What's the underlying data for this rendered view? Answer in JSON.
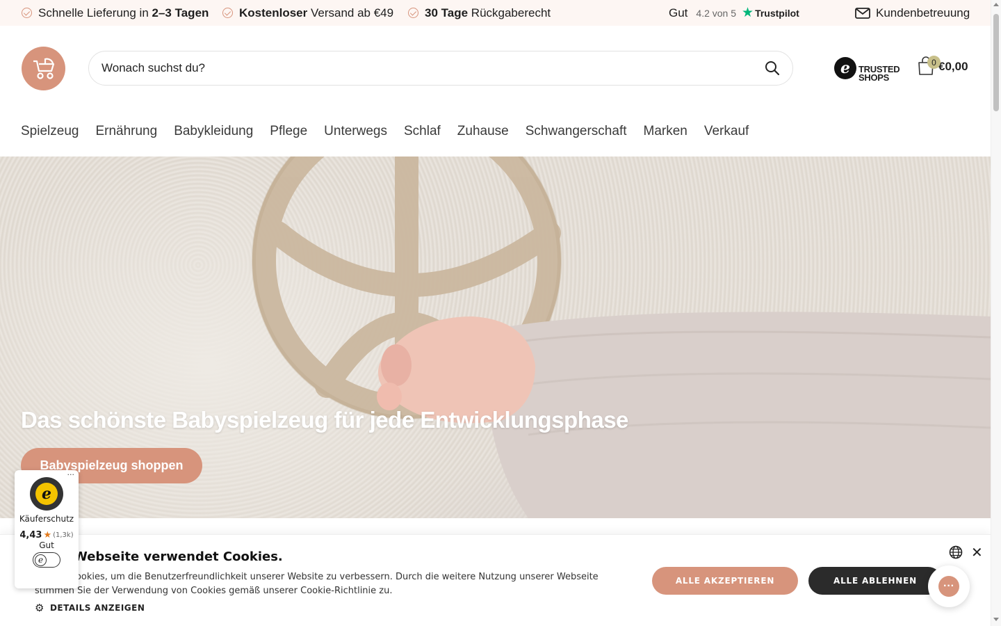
{
  "topbar": {
    "usps": [
      {
        "pre": "Schnelle Lieferung in ",
        "bold": "2–3 Tagen",
        "post": ""
      },
      {
        "pre": "",
        "bold": "Kostenloser",
        "post": " Versand ab €49"
      },
      {
        "pre": "",
        "bold": "30 Tage",
        "post": " Rückgaberecht"
      }
    ],
    "trustpilot": {
      "grade": "Gut",
      "score": "4.2 von 5",
      "brand": "Trustpilot"
    },
    "support_label": "Kundenbetreuung"
  },
  "header": {
    "search_placeholder": "Wonach suchst du?",
    "trusted_shops": {
      "line1": "TRUSTED",
      "line2": "SHOPS"
    },
    "cart": {
      "count": "0",
      "total": "€0,00"
    }
  },
  "nav": [
    "Spielzeug",
    "Ernährung",
    "Babykleidung",
    "Pflege",
    "Unterwegs",
    "Schlaf",
    "Zuhause",
    "Schwangerschaft",
    "Marken",
    "Verkauf"
  ],
  "hero": {
    "title": "Das schönste Babyspielzeug für jede Entwicklungsphase",
    "button": "Babyspielzeug shoppen"
  },
  "cookie": {
    "title": "Webseite verwendet Cookies.",
    "text": "…nden Cookies, um die Benutzerfreundlichkeit unserer Website zu verbessern. Durch die weitere Nutzung unserer Webseite stimmen Sie der Verwendung von Cookies gemäß unserer Cookie-Richtlinie zu.",
    "details": "DETAILS ANZEIGEN",
    "accept": "ALLE AKZEPTIEREN",
    "reject": "ALLE ABLEHNEN"
  },
  "trusted_widget": {
    "label": "Käuferschutz",
    "rating": "4,43",
    "count": "(1,3k)",
    "grade": "Gut"
  },
  "colors": {
    "accent": "#d7947c",
    "dark": "#2b2b2b",
    "trustpilot": "#00b67a"
  }
}
